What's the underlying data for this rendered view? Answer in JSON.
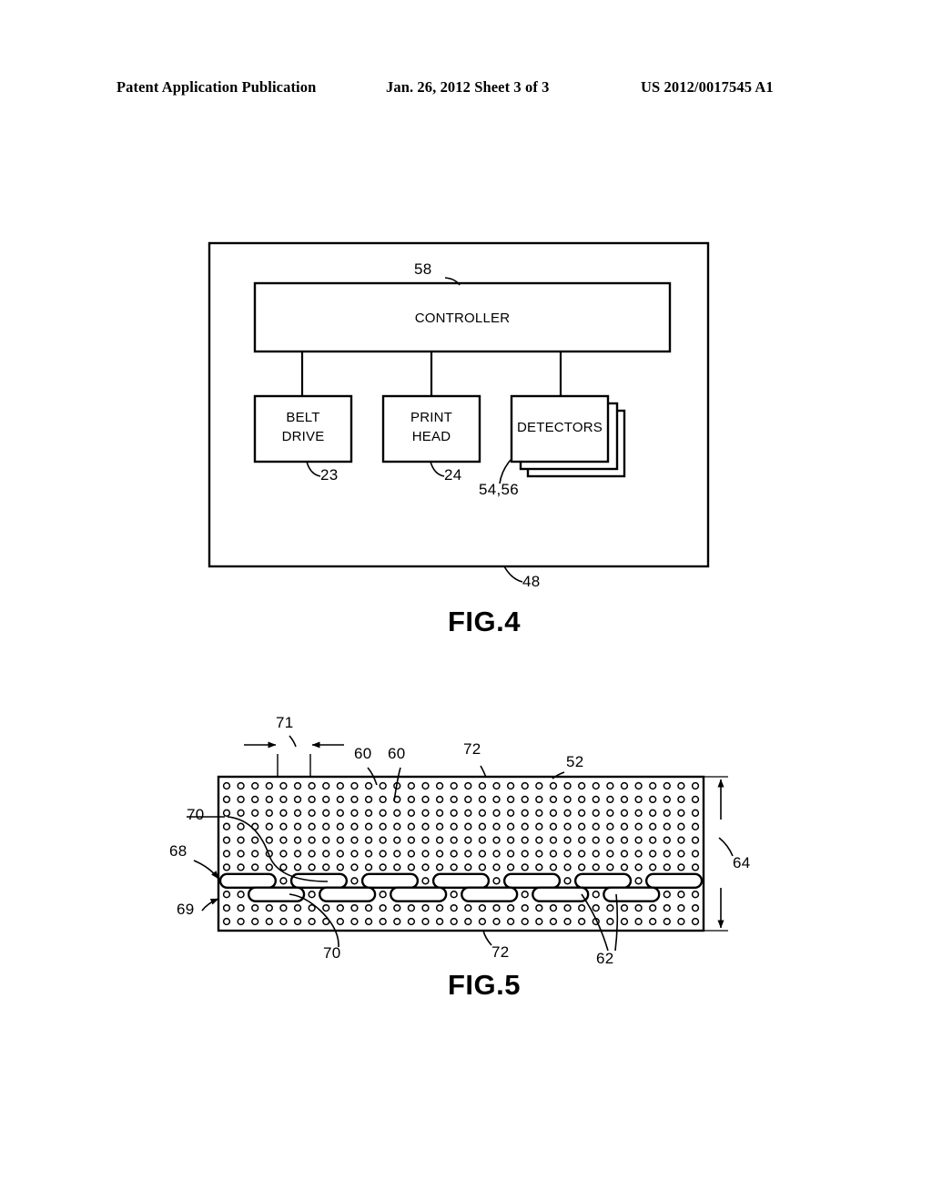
{
  "header": {
    "publication": "Patent Application Publication",
    "date_sheet": "Jan. 26, 2012  Sheet 3 of 3",
    "doc_number": "US 2012/0017545 A1"
  },
  "figures": [
    {
      "caption": "FIG.4",
      "type": "block-diagram",
      "enclosure_ref": "48",
      "blocks": [
        {
          "label": "CONTROLLER",
          "ref": "58"
        },
        {
          "label": "BELT\nDRIVE",
          "ref": "23"
        },
        {
          "label": "PRINT\nHEAD",
          "ref": "24"
        },
        {
          "label": "DETECTORS",
          "ref": "54,56"
        }
      ]
    },
    {
      "caption": "FIG.5",
      "type": "perforated-panel",
      "refs": {
        "pitch": "71",
        "hole_upper_a": "60",
        "hole_upper_b": "60",
        "panel_field_top": "72",
        "panel": "52",
        "slot_upper_left": "70",
        "row_upper": "68",
        "row_lower": "69",
        "height": "64",
        "slot_lower_bottom": "70",
        "panel_field_bottom": "72",
        "slot_group": "62"
      }
    }
  ],
  "colors": {
    "ink": "#000000",
    "paper": "#ffffff"
  }
}
